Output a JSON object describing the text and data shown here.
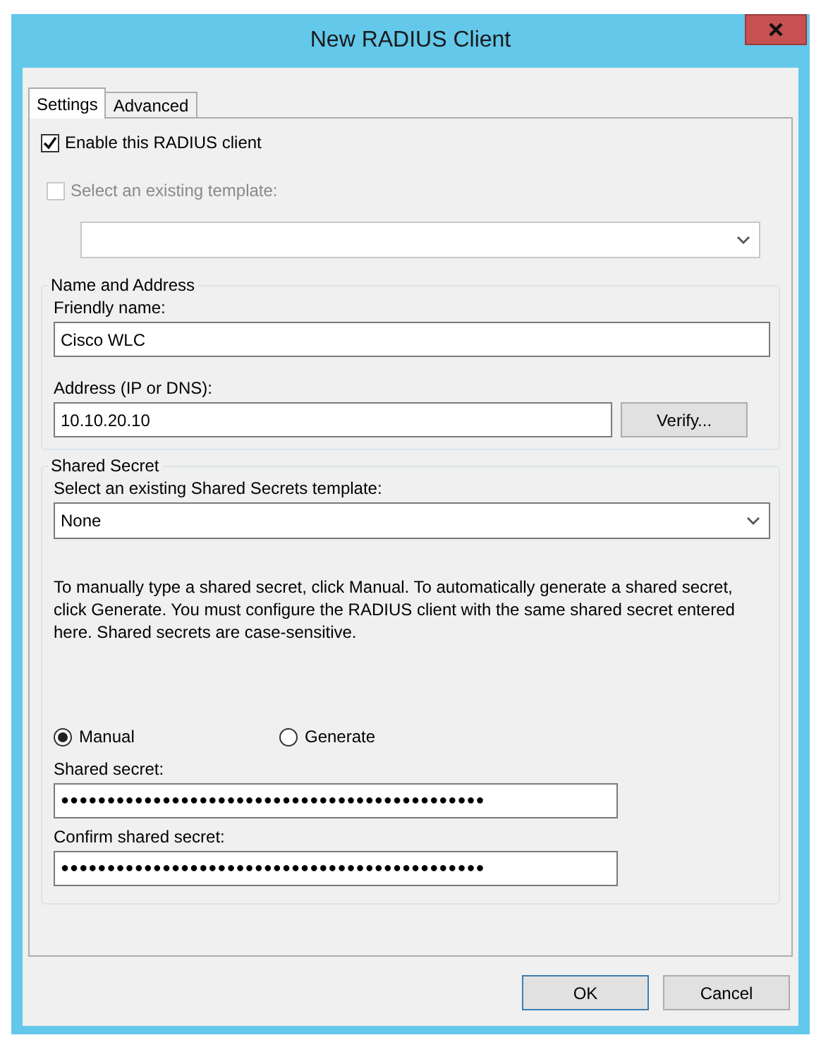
{
  "window": {
    "title": "New RADIUS Client"
  },
  "tabs": [
    {
      "label": "Settings",
      "selected": true
    },
    {
      "label": "Advanced",
      "selected": false
    }
  ],
  "enable_client": {
    "label": "Enable this RADIUS client",
    "checked": true,
    "disabled": false
  },
  "template": {
    "label": "Select an existing template:",
    "checked": false,
    "disabled": true
  },
  "name_and_address": {
    "title": "Name and Address",
    "friendly_name_label": "Friendly name:",
    "friendly_name": "Cisco WLC",
    "address_label": "Address (IP or DNS):",
    "address": "10.10.20.10",
    "verify_button": "Verify..."
  },
  "shared_secret": {
    "title": "Shared Secret",
    "template_label": "Select an existing Shared Secrets template:",
    "template_value": "None",
    "description": "To manually type a shared secret, click Manual. To automatically generate a shared secret, click Generate. You must configure the RADIUS client with the same shared secret entered here. Shared secrets are case-sensitive.",
    "modes": [
      {
        "label": "Manual",
        "selected": true
      },
      {
        "label": "Generate",
        "selected": false
      }
    ],
    "secret_label": "Shared secret:",
    "secret": "●●●●●●●●●●●●●●●●●●●●●●●●●●●●●●●●●●●●●●●●●●●●●●",
    "confirm_label": "Confirm shared secret:",
    "confirm": "●●●●●●●●●●●●●●●●●●●●●●●●●●●●●●●●●●●●●●●●●●●●●●"
  },
  "buttons": [
    {
      "label": "OK",
      "kind": "default"
    },
    {
      "label": "Cancel",
      "kind": "normal"
    }
  ]
}
